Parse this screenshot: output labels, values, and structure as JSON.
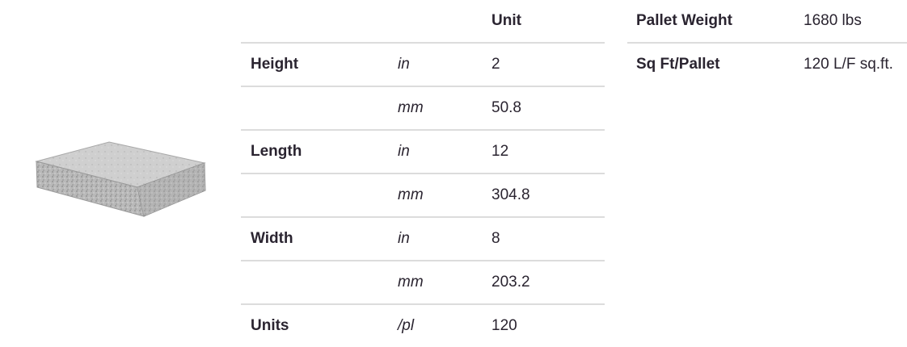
{
  "spec_table": {
    "header": [
      "",
      "",
      "Unit"
    ],
    "rows": [
      {
        "label": "Height",
        "unit": "in",
        "value": "2"
      },
      {
        "label": "",
        "unit": "mm",
        "value": "50.8"
      },
      {
        "label": "Length",
        "unit": "in",
        "value": "12"
      },
      {
        "label": "",
        "unit": "mm",
        "value": "304.8"
      },
      {
        "label": "Width",
        "unit": "in",
        "value": "8"
      },
      {
        "label": "",
        "unit": "mm",
        "value": "203.2"
      },
      {
        "label": "Units",
        "unit": "/pl",
        "value": "120"
      }
    ]
  },
  "pallet": [
    {
      "label": "Pallet Weight",
      "value": "1680 lbs"
    },
    {
      "label": "Sq Ft/Pallet",
      "value": "120 L/F sq.ft."
    }
  ],
  "colors": {
    "text": "#2a2430",
    "divider": "#dcdcdc"
  }
}
